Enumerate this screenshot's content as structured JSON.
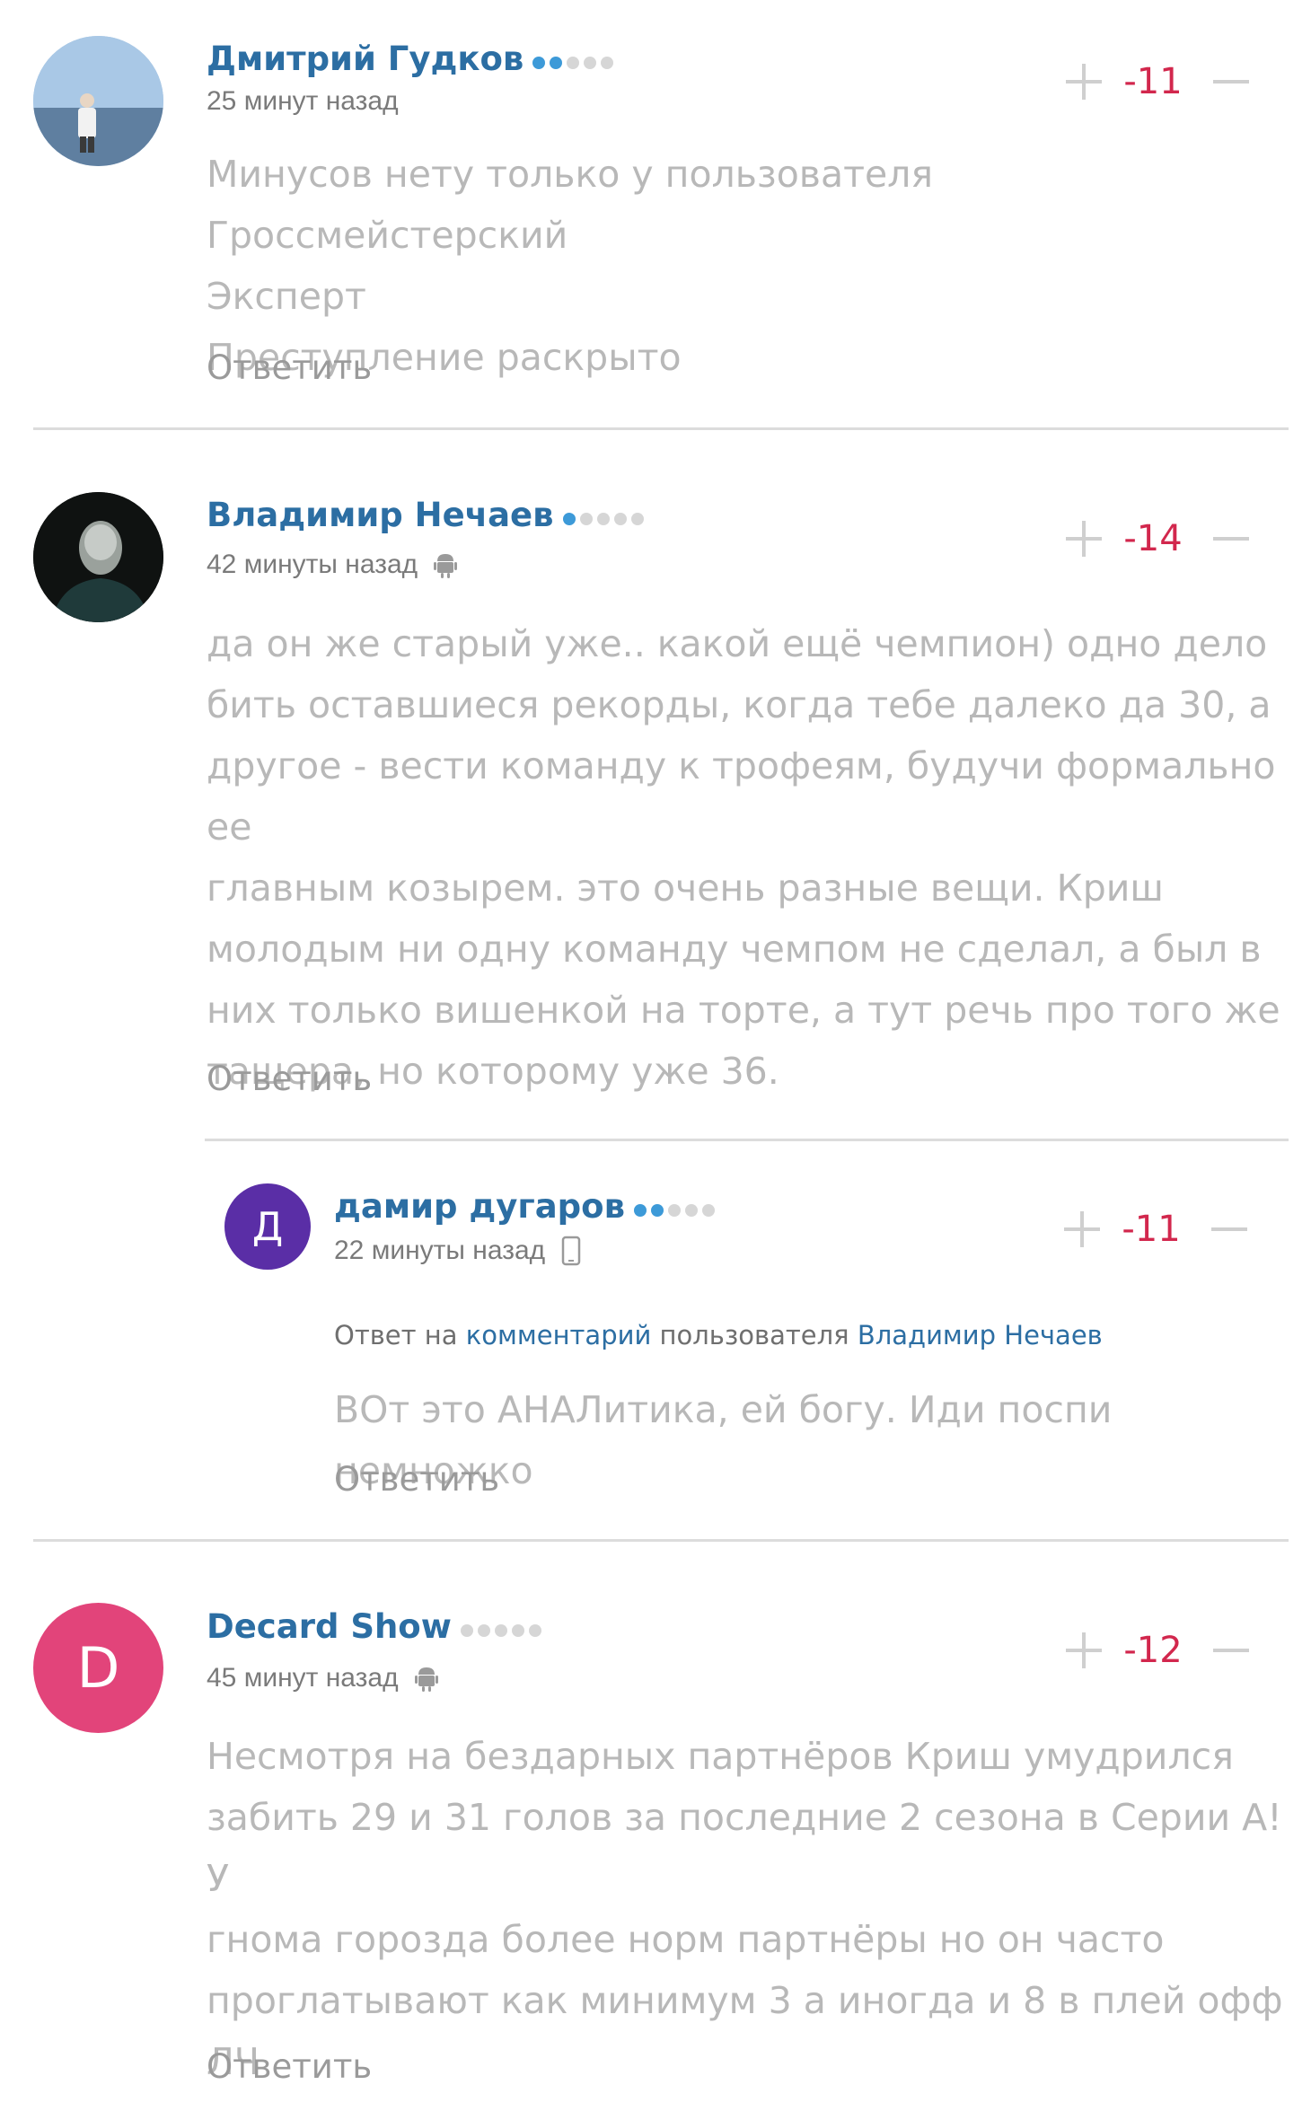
{
  "comments": [
    {
      "author": "Дмитрий Гудков",
      "time": "25 минут назад",
      "rating": "-11",
      "rank_dots": [
        true,
        true,
        false,
        false,
        false
      ],
      "device": "",
      "text": [
        "Минусов нету только у пользователя Гроссмейстерский",
        "Эксперт",
        "Преступление раскрыто"
      ],
      "reply_label": "Ответить"
    },
    {
      "author": "Владимир Нечаев",
      "time": "42 минуты назад",
      "rating": "-14",
      "rank_dots": [
        true,
        false,
        false,
        false,
        false
      ],
      "device": "android-icon",
      "text": [
        "да он же старый уже.. какой ещё чемпион) одно дело",
        "бить оставшиеся рекорды, когда тебе далеко да 30, а",
        "другое - вести команду к трофеям, будучи формально ее",
        "главным козырем. это очень разные вещи. Криш",
        "молодым ни одну команду чемпом не сделал, а был в",
        "них только вишенкой на торте, а тут речь про того же",
        "тащера, но которому уже 36."
      ],
      "reply_label": "Ответить"
    },
    {
      "author": "дамир дугаров",
      "avatar_letter": "Д",
      "avatar_color": "#5a2ea6",
      "time": "22 минуты назад",
      "rating": "-11",
      "rank_dots": [
        true,
        true,
        false,
        false,
        false
      ],
      "device": "phone-icon",
      "reply_to_prefix": "Ответ на",
      "reply_to_link": "комментарий",
      "reply_to_middle": "пользователя",
      "reply_to_user": "Владимир Нечаев",
      "text": [
        "ВОт это АНАЛитика, ей богу. Иди поспи немножко"
      ],
      "reply_label": "Ответить"
    },
    {
      "author": "Decard Show",
      "avatar_letter": "D",
      "avatar_color": "#e2447a",
      "time": "45 минут назад",
      "rating": "-12",
      "rank_dots": [
        false,
        false,
        false,
        false,
        false
      ],
      "device": "android-icon",
      "text": [
        "Несмотря на бездарных партнёров Криш умудрился",
        "забить 29 и 31 голов за последние 2 сезона в Серии А! У",
        "гнома горозда более норм партнёры но он часто",
        "проглатывают как минимум 3 а иногда и 8 в плей офф",
        "ЛЧ"
      ],
      "reply_label": "Ответить"
    }
  ]
}
